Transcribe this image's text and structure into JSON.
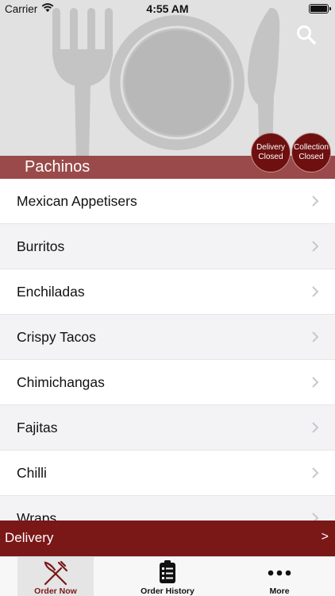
{
  "status_bar": {
    "carrier": "Carrier",
    "time": "4:55 AM"
  },
  "header": {
    "restaurant_name": "Pachinos",
    "search_icon": "search-icon",
    "hero_icons": [
      "fork-icon",
      "plate-icon",
      "knife-icon"
    ],
    "delivery_badge": {
      "line1": "Delivery",
      "line2": "Closed"
    },
    "collection_badge": {
      "line1": "Collection",
      "line2": "Closed"
    }
  },
  "menu": {
    "categories": [
      "Mexican Appetisers",
      "Burritos",
      "Enchiladas",
      "Crispy Tacos",
      "Chimichangas",
      "Fajitas",
      "Chilli",
      "Wraps"
    ]
  },
  "order_bar": {
    "label": "Delivery",
    "arrow": ">"
  },
  "tabs": [
    {
      "label": "Order Now",
      "icon": "fork-knife-icon",
      "selected": true
    },
    {
      "label": "Order History",
      "icon": "clipboard-icon",
      "selected": false
    },
    {
      "label": "More",
      "icon": "more-dots-icon",
      "selected": false
    }
  ],
  "colors": {
    "brand": "#7a1717",
    "band": "#9a4a4a",
    "badge": "#6e1010",
    "hero_bg": "#e1e1e1"
  }
}
